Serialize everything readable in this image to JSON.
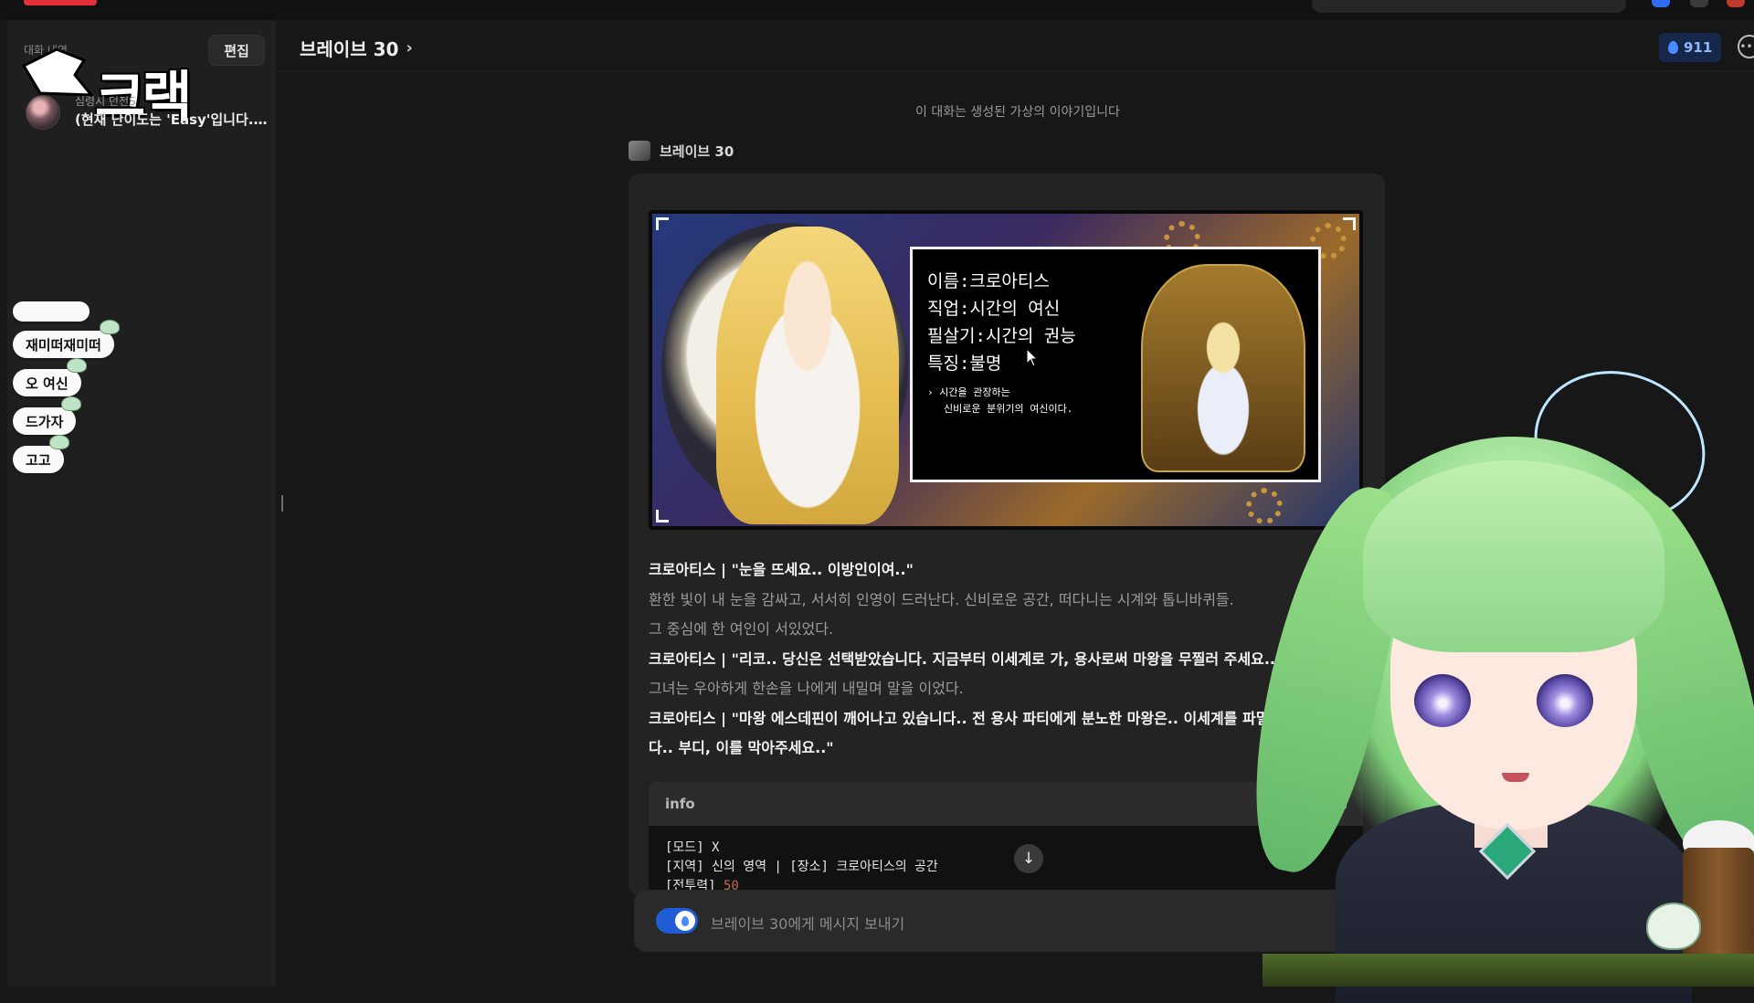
{
  "sidebar": {
    "history_label": "대화 내역",
    "edit_label": "편집",
    "logo_text": "크랙",
    "chat": {
      "name": "심령시 던전S",
      "preview": "(현재 난이도는 'Easy'입니다. ..."
    }
  },
  "chat_bubbles": [
    "재미떠재미떠",
    "오 여신",
    "드가자",
    "고고"
  ],
  "header": {
    "title": "브레이브 30",
    "credits": "911"
  },
  "conversation": {
    "notice": "이 대화는 생성된 가상의 이야기입니다",
    "speaker": "브레이브 30"
  },
  "game_panel": {
    "lines": [
      "이름:크로아티스",
      "직업:시간의 여신",
      "필살기:시간의 권능",
      "특징:불명"
    ],
    "desc_line1": "시간을 관장하는",
    "desc_line2": "신비로운 분위기의 여신이다."
  },
  "story": [
    {
      "style": "bold",
      "text": "크로아티스 | \"눈을 뜨세요.. 이방인이여..\""
    },
    {
      "style": "grey",
      "text": "환한 빛이 내 눈을 감싸고, 서서히 인영이 드러난다. 신비로운 공간, 떠다니는 시계와 톱니바퀴들."
    },
    {
      "style": "grey",
      "text": "그 중심에 한 여인이 서있었다."
    },
    {
      "style": "bold",
      "text": "크로아티스 | \"리코.. 당신은 선택받았습니다. 지금부터 이세계로 가, 용사로써 마왕을 무찔러 주세요..\""
    },
    {
      "style": "grey",
      "text": "그녀는 우아하게 한손을 나에게 내밀며 말을 이었다."
    },
    {
      "style": "bold",
      "text": "크로아티스 | \"마왕 에스데핀이 깨어나고 있습니다.. 전 용사 파티에게 분노한 마왕은.. 이세계를 파멸로"
    },
    {
      "style": "bold",
      "text": "다.. 부디, 이를 막아주세요..\""
    }
  ],
  "info_box": {
    "title": "info",
    "line1": "[모드] X",
    "line2": "[지역] 신의 영역 | [장소] 크로아티스의 공간",
    "line3_label": "[전투력] ",
    "line3_value": "50"
  },
  "composer": {
    "placeholder": "브레이브 30에게 메시지 보내기"
  },
  "icons": [
    "more-icon",
    "drop-icon",
    "chevron-right-icon",
    "arrow-down-icon",
    "copy-icon"
  ],
  "colors": {
    "background": "#171717",
    "sidebar": "#1f1f1f",
    "accent_blue": "#1f5cd6",
    "credit_text": "#8fb8ff"
  }
}
